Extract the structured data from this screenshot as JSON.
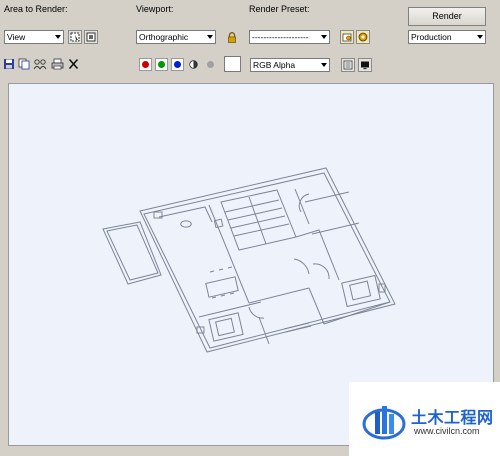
{
  "toolbar": {
    "area_label": "Area to Render:",
    "area_value": "View",
    "viewport_label": "Viewport:",
    "viewport_value": "Orthographic",
    "preset_label": "Render Preset:",
    "preset_value": "--------------------",
    "render_button": "Render",
    "mode_value": "Production",
    "channel_value": "RGB Alpha"
  },
  "colors": {
    "red": "#cc0000",
    "green": "#009900",
    "blue": "#0022cc",
    "mono": "#555555",
    "alpha": "#a0a0a0",
    "viewport_bg": "#eef2fb",
    "drawing_line": "#7d8595"
  },
  "icons": [
    "save-icon",
    "copy-icon",
    "clone-icon",
    "print-icon",
    "clear-icon",
    "lock-icon",
    "region-icon",
    "crop-icon",
    "preset-open-icon",
    "teapot-icon",
    "channel-display-icon",
    "mono-icon"
  ],
  "watermark": {
    "site_name": "土木工程网",
    "url": "www.civilcn.com"
  }
}
